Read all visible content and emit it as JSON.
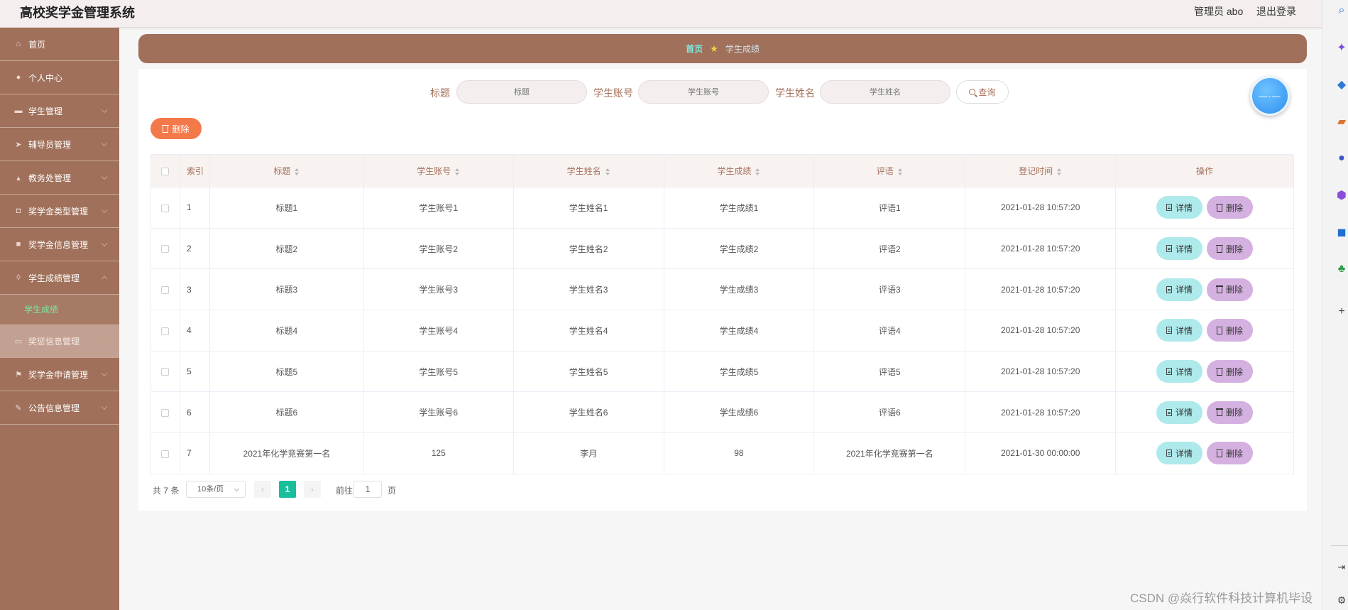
{
  "header": {
    "title": "高校奖学金管理系统",
    "user": "管理员 abo",
    "logout": "退出登录"
  },
  "sidebar": {
    "items": [
      {
        "label": "首页",
        "icon": "home-icon"
      },
      {
        "label": "个人中心",
        "icon": "user-icon"
      },
      {
        "label": "学生管理",
        "icon": "chat-icon"
      },
      {
        "label": "辅导员管理",
        "icon": "send-icon"
      },
      {
        "label": "教务处管理",
        "icon": "thumb-icon"
      },
      {
        "label": "奖学金类型管理",
        "icon": "tag-icon"
      },
      {
        "label": "奖学金信息管理",
        "icon": "file-icon"
      },
      {
        "label": "学生成绩管理",
        "icon": "bulb-icon"
      },
      {
        "label": "奖惩信息管理",
        "icon": "message-icon"
      },
      {
        "label": "奖学金申请管理",
        "icon": "flag-icon"
      },
      {
        "label": "公告信息管理",
        "icon": "edit-icon"
      }
    ],
    "active_sub": "学生成绩"
  },
  "breadcrumb": {
    "home": "首页",
    "current": "学生成绩"
  },
  "search": {
    "fields": [
      {
        "label": "标题",
        "placeholder": "标题"
      },
      {
        "label": "学生账号",
        "placeholder": "学生账号"
      },
      {
        "label": "学生姓名",
        "placeholder": "学生姓名"
      }
    ],
    "button": "查询"
  },
  "toolbar": {
    "delete_label": "删除"
  },
  "table": {
    "columns": [
      "索引",
      "标题",
      "学生账号",
      "学生姓名",
      "学生成绩",
      "评语",
      "登记时间",
      "操作"
    ],
    "rows": [
      [
        "1",
        "标题1",
        "学生账号1",
        "学生姓名1",
        "学生成绩1",
        "评语1",
        "2021-01-28 10:57:20"
      ],
      [
        "2",
        "标题2",
        "学生账号2",
        "学生姓名2",
        "学生成绩2",
        "评语2",
        "2021-01-28 10:57:20"
      ],
      [
        "3",
        "标题3",
        "学生账号3",
        "学生姓名3",
        "学生成绩3",
        "评语3",
        "2021-01-28 10:57:20"
      ],
      [
        "4",
        "标题4",
        "学生账号4",
        "学生姓名4",
        "学生成绩4",
        "评语4",
        "2021-01-28 10:57:20"
      ],
      [
        "5",
        "标题5",
        "学生账号5",
        "学生姓名5",
        "学生成绩5",
        "评语5",
        "2021-01-28 10:57:20"
      ],
      [
        "6",
        "标题6",
        "学生账号6",
        "学生姓名6",
        "学生成绩6",
        "评语6",
        "2021-01-28 10:57:20"
      ],
      [
        "7",
        "2021年化学竞赛第一名",
        "125",
        "李月",
        "98",
        "2021年化学竞赛第一名",
        "2021-01-30 00:00:00"
      ]
    ],
    "detail_label": "详情",
    "delete_label": "删除"
  },
  "pagination": {
    "total": "共 7 条",
    "page_size": "10条/页",
    "current_page": "1",
    "goto_prefix": "前往",
    "goto_value": "1",
    "goto_suffix": "页"
  },
  "watermark": "CSDN @焱行软件科技计算机毕设",
  "colors": {
    "sidebar": "#a0705a",
    "accent_text": "#a5715c",
    "delete_button": "#f4794a",
    "detail_button": "#aeeaeb",
    "row_delete_button": "#d4b1e0",
    "pager_active": "#19be9b"
  }
}
